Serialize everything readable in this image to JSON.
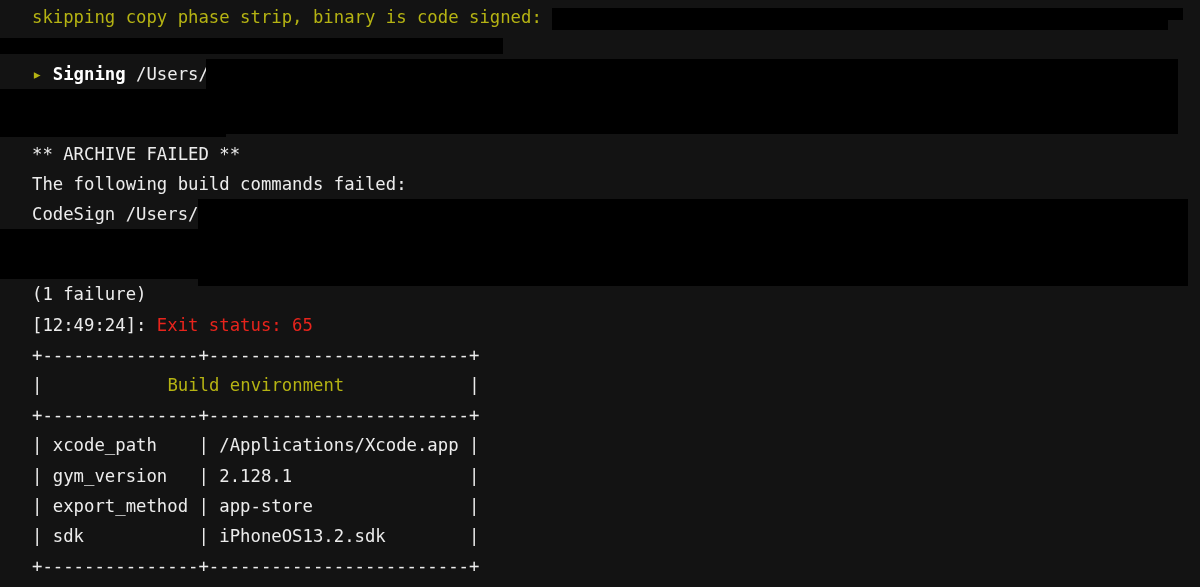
{
  "terminal": {
    "lines": [
      {
        "redacted": true,
        "segments": [
          {
            "text": "skipping copy phase strip, binary is code signed:",
            "kind": "yellow"
          }
        ]
      },
      {
        "redacted": true,
        "segments": [
          {
            "text": "▸",
            "kind": "yellow"
          },
          {
            "text": "Signing",
            "kind": "bold"
          },
          {
            "text": "/Users/",
            "kind": "plain"
          }
        ]
      },
      {
        "redacted": false,
        "segments": [
          {
            "text": "** ARCHIVE FAILED **",
            "kind": "plain"
          }
        ]
      },
      {
        "redacted": false,
        "segments": [
          {
            "text": "The following build commands failed:",
            "kind": "plain"
          }
        ]
      },
      {
        "redacted": true,
        "segments": [
          {
            "text": "CodeSign /Users/",
            "kind": "plain"
          }
        ]
      },
      {
        "redacted": false,
        "segments": [
          {
            "text": "(1 failure)",
            "kind": "plain"
          }
        ]
      },
      {
        "redacted": false,
        "segments": [
          {
            "text": "[12:49:24]:",
            "kind": "plain"
          },
          {
            "text": "Exit status: 65",
            "kind": "red"
          }
        ]
      },
      {
        "redacted": false,
        "segments": [
          {
            "text": "+---------------+-------------------------+",
            "kind": "plain"
          }
        ]
      },
      {
        "redacted": false,
        "segments": [
          {
            "text": "|",
            "kind": "plain"
          },
          {
            "text": "Build environment",
            "kind": "yellow"
          },
          {
            "text": "|",
            "kind": "plain"
          }
        ]
      },
      {
        "redacted": false,
        "segments": [
          {
            "text": "+---------------+-------------------------+",
            "kind": "plain"
          }
        ]
      },
      {
        "redacted": false,
        "segments": [
          {
            "text": "| xcode_path    | /Applications/Xcode.app |",
            "kind": "plain"
          }
        ]
      },
      {
        "redacted": false,
        "segments": [
          {
            "text": "| gym_version   | 2.128.1                 |",
            "kind": "plain"
          }
        ]
      },
      {
        "redacted": false,
        "segments": [
          {
            "text": "| export_method | app-store               |",
            "kind": "plain"
          }
        ]
      },
      {
        "redacted": false,
        "segments": [
          {
            "text": "| sdk           | iPhoneOS13.2.sdk        |",
            "kind": "plain"
          }
        ]
      },
      {
        "redacted": false,
        "segments": [
          {
            "text": "+---------------+-------------------------+",
            "kind": "plain"
          }
        ]
      }
    ]
  }
}
